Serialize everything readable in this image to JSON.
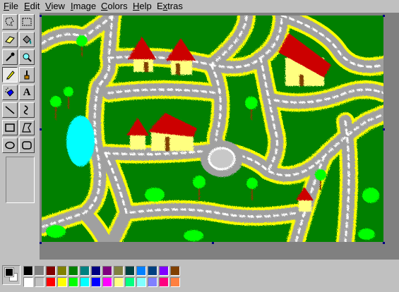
{
  "menubar": {
    "items": [
      {
        "label": "File",
        "accel": "F",
        "rest": "ile"
      },
      {
        "label": "Edit",
        "accel": "E",
        "rest": "dit"
      },
      {
        "label": "View",
        "accel": "V",
        "rest": "iew"
      },
      {
        "label": "Image",
        "accel": "I",
        "rest": "mage"
      },
      {
        "label": "Colors",
        "accel": "C",
        "rest": "olors"
      },
      {
        "label": "Help",
        "accel": "H",
        "rest": "elp"
      },
      {
        "label": "Extras",
        "accel": "x",
        "pre": "E",
        "rest": "tras"
      }
    ]
  },
  "toolbox": {
    "tools": [
      {
        "name": "free-form-select",
        "icon": "free-form-select-icon"
      },
      {
        "name": "rect-select",
        "icon": "rect-select-icon"
      },
      {
        "name": "eraser",
        "icon": "eraser-icon"
      },
      {
        "name": "fill",
        "icon": "paint-bucket-icon"
      },
      {
        "name": "pick-color",
        "icon": "eyedropper-icon"
      },
      {
        "name": "magnifier",
        "icon": "magnifier-icon"
      },
      {
        "name": "pencil",
        "icon": "pencil-icon",
        "active": true
      },
      {
        "name": "brush",
        "icon": "brush-icon"
      },
      {
        "name": "airbrush",
        "icon": "airbrush-icon"
      },
      {
        "name": "text",
        "icon": "text-icon",
        "glyph": "A"
      },
      {
        "name": "line",
        "icon": "line-icon"
      },
      {
        "name": "curve",
        "icon": "curve-icon"
      },
      {
        "name": "rectangle",
        "icon": "rectangle-icon"
      },
      {
        "name": "polygon",
        "icon": "polygon-icon"
      },
      {
        "name": "ellipse",
        "icon": "ellipse-icon"
      },
      {
        "name": "rounded-rectangle",
        "icon": "rounded-rectangle-icon"
      }
    ]
  },
  "palette": {
    "foreground": "#000000",
    "background": "#ffffff",
    "top_row": [
      "#000000",
      "#808080",
      "#800000",
      "#808000",
      "#008000",
      "#008080",
      "#000080",
      "#800080",
      "#808040",
      "#004040",
      "#0080ff",
      "#004080",
      "#8000ff",
      "#804000"
    ],
    "bottom_row": [
      "#ffffff",
      "#c0c0c0",
      "#ff0000",
      "#ffff00",
      "#00ff00",
      "#00ffff",
      "#0000ff",
      "#ff00ff",
      "#ffff80",
      "#00ff80",
      "#80ffff",
      "#8080ff",
      "#ff0080",
      "#ff8040"
    ]
  },
  "canvas": {
    "background": "#008000",
    "road_color": "#a0a0a0",
    "road_edge_color": "#ffff00",
    "roof_color": "#cc0000",
    "wall_color": "#ffff80",
    "tree_color": "#00ff00",
    "water_color": "#00ffff"
  }
}
